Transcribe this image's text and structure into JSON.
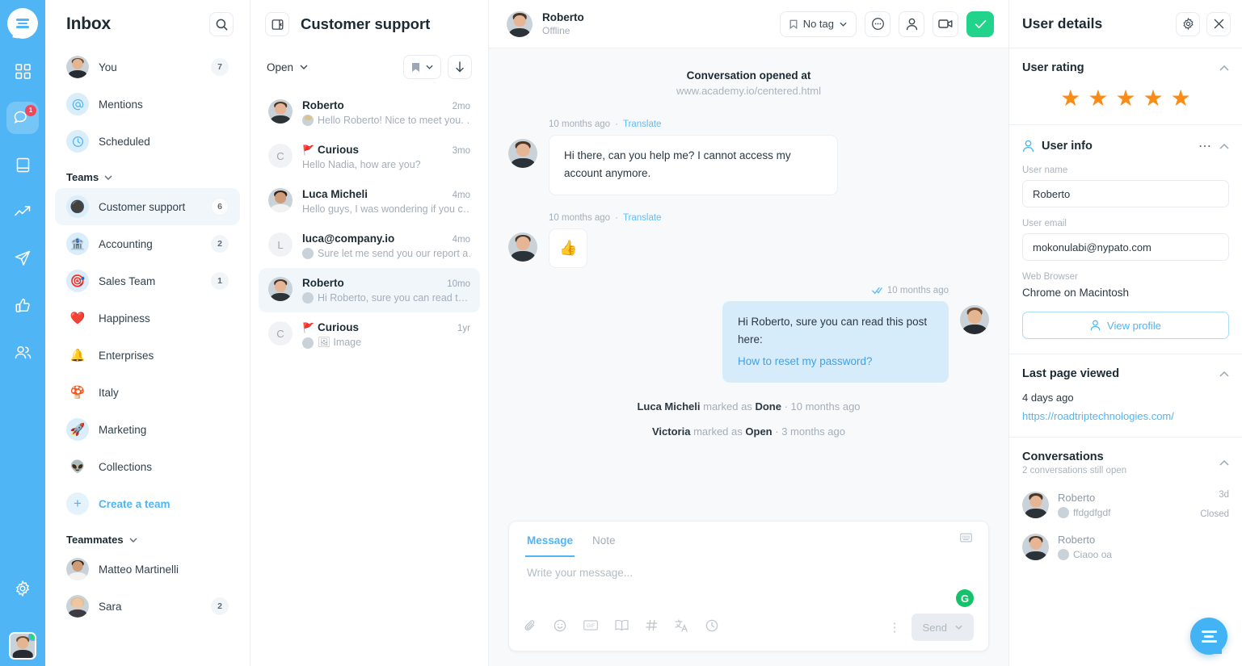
{
  "rail": {
    "logo": "messenger-logo",
    "items": [
      {
        "name": "apps-grid-icon",
        "badge": ""
      },
      {
        "name": "conversations-icon",
        "badge": "1",
        "active": true
      },
      {
        "name": "book-icon",
        "badge": ""
      },
      {
        "name": "analytics-trend-icon",
        "badge": ""
      },
      {
        "name": "send-paperplane-icon",
        "badge": ""
      },
      {
        "name": "thumbs-up-icon",
        "badge": ""
      },
      {
        "name": "contacts-people-icon",
        "badge": ""
      }
    ],
    "settings_icon": "gear-icon"
  },
  "inbox": {
    "title": "Inbox",
    "search_icon": "search-icon",
    "items": [
      {
        "label": "You",
        "count": "7",
        "icon": "avatar-you"
      },
      {
        "label": "Mentions",
        "count": "",
        "icon": "at-icon"
      },
      {
        "label": "Scheduled",
        "count": "",
        "icon": "clock-icon"
      }
    ],
    "teams_header": "Teams",
    "teams": [
      {
        "label": "Customer support",
        "count": "6",
        "emoji": "⚫",
        "active": true
      },
      {
        "label": "Accounting",
        "count": "2",
        "emoji": "🏦"
      },
      {
        "label": "Sales Team",
        "count": "1",
        "emoji": "🎯"
      },
      {
        "label": "Happiness",
        "count": "",
        "emoji": "❤️"
      },
      {
        "label": "Enterprises",
        "count": "",
        "emoji": "🔔"
      },
      {
        "label": "Italy",
        "count": "",
        "emoji": "🍄"
      },
      {
        "label": "Marketing",
        "count": "",
        "emoji": "🚀"
      },
      {
        "label": "Collections",
        "count": "",
        "emoji": "👽"
      }
    ],
    "create_team": "Create a team",
    "teammates_header": "Teammates",
    "teammates": [
      {
        "label": "Matteo Martinelli",
        "count": ""
      },
      {
        "label": "Sara",
        "count": "2"
      }
    ]
  },
  "convlist": {
    "title": "Customer support",
    "collapse_icon": "panel-collapse-icon",
    "filter_label": "Open",
    "bookmark_icon": "bookmark-icon",
    "sort_icon": "sort-down-arrow-icon",
    "items": [
      {
        "name": "Roberto",
        "time": "2mo",
        "preview": "Hello Roberto! Nice to meet you. …",
        "flagged": false,
        "avatar": "m1",
        "initial": ""
      },
      {
        "name": "Curious",
        "time": "3mo",
        "preview": "Hello Nadia, how are you?",
        "flagged": true,
        "avatar": "letter",
        "initial": "C"
      },
      {
        "name": "Luca Micheli",
        "time": "4mo",
        "preview": "Hello guys, I was wondering if you c…",
        "flagged": false,
        "avatar": "m2",
        "initial": ""
      },
      {
        "name": "luca@company.io",
        "time": "4mo",
        "preview": "Sure let me send you our report a…",
        "flagged": false,
        "avatar": "letter",
        "initial": "L"
      },
      {
        "name": "Roberto",
        "time": "10mo",
        "preview": "Hi Roberto, sure you can read t…",
        "flagged": false,
        "avatar": "m1",
        "initial": "",
        "active": true
      },
      {
        "name": "Curious",
        "time": "1yr",
        "preview": "🖼 Image",
        "flagged": true,
        "avatar": "letter",
        "initial": "C"
      }
    ]
  },
  "chat": {
    "header": {
      "name": "Roberto",
      "status": "Offline",
      "tag_label": "No tag",
      "tag_icon": "bookmark-icon",
      "more_icon": "more-circle-icon",
      "assign_icon": "person-icon",
      "video_icon": "video-camera-icon",
      "resolve_icon": "check-icon",
      "resolve_color": "#22D38B"
    },
    "opened_title": "Conversation opened at",
    "opened_url": "www.academy.io/centered.html",
    "messages": [
      {
        "dir": "in",
        "time": "10 months ago",
        "translate": "Translate",
        "text": "Hi there, can you help me? I cannot access my account anymore.",
        "avatar": "m1",
        "emoji": false
      },
      {
        "dir": "in",
        "time": "10 months ago",
        "translate": "Translate",
        "text": "👍",
        "avatar": "m1",
        "emoji": true
      },
      {
        "dir": "out",
        "time": "10 months ago",
        "translate": "",
        "text": "Hi Roberto, sure you can read this post here:",
        "link": "How to reset my password?",
        "avatar": "m4",
        "emoji": false,
        "read_icon": "double-check-icon"
      }
    ],
    "system_lines": [
      {
        "actor": "Luca Micheli",
        "action": "marked as",
        "state": "Done",
        "time": "10 months ago"
      },
      {
        "actor": "Victoria",
        "action": "marked as",
        "state": "Open",
        "time": "3 months ago"
      }
    ],
    "composer": {
      "tab_message": "Message",
      "tab_note": "Note",
      "keyboard_icon": "keyboard-shortcut-icon",
      "placeholder": "Write your message...",
      "tools": [
        "attachment-paperclip-icon",
        "emoji-smiley-icon",
        "gif-icon",
        "knowledge-book-icon",
        "hashtag-icon",
        "translate-icon",
        "schedule-clock-icon"
      ],
      "grammarly_label": "G",
      "more_icon": "more-vertical-icon",
      "send_label": "Send",
      "send_chevron": "chevron-down-icon"
    }
  },
  "details": {
    "title": "User details",
    "gear_icon": "gear-icon",
    "close_icon": "close-icon",
    "rating": {
      "title": "User rating",
      "value": 5,
      "max": 5,
      "color": "#FA8C16"
    },
    "user_info": {
      "title": "User info",
      "person_icon": "person-icon",
      "more_icon": "more-horizontal-icon",
      "name_label": "User name",
      "name_value": "Roberto",
      "email_label": "User email",
      "email_value": "mokonulabi@nypato.com",
      "browser_label": "Web Browser",
      "browser_value": "Chrome on Macintosh",
      "view_profile": "View profile"
    },
    "last_page": {
      "title": "Last page viewed",
      "time": "4 days ago",
      "url": "https://roadtriptechnologies.com/"
    },
    "conversations": {
      "title": "Conversations",
      "subtitle": "2 conversations still open",
      "items": [
        {
          "name": "Roberto",
          "preview": "ffdgdfgdf",
          "time": "3d",
          "state": "Closed"
        },
        {
          "name": "Roberto",
          "preview": "Ciaoo oa",
          "time": "",
          "state": ""
        }
      ]
    },
    "fab_icon": "chat-widget-icon"
  }
}
